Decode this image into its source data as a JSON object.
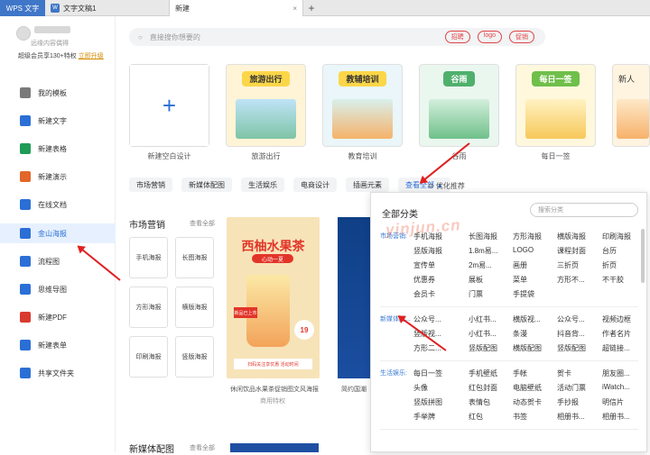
{
  "tabs": {
    "wps_label": "WPS 文字",
    "doc_label": "文字文稿1",
    "new_label": "新建",
    "close": "×",
    "add": "+"
  },
  "user": {
    "subtitle": "远缘内容偶得",
    "vip_text": "超级会员享130+特权",
    "vip_link": "立即升级"
  },
  "nav": [
    {
      "label": "我的模板",
      "icon": "template-icon",
      "color": "#7a7a7a"
    },
    {
      "label": "新建文字",
      "icon": "doc-icon",
      "color": "#2b6fd6"
    },
    {
      "label": "新建表格",
      "icon": "sheet-icon",
      "color": "#1e9b57"
    },
    {
      "label": "新建演示",
      "icon": "slides-icon",
      "color": "#e2662a"
    },
    {
      "label": "在线文档",
      "icon": "cloud-doc-icon",
      "color": "#2b6fd6"
    },
    {
      "label": "金山海报",
      "icon": "poster-icon",
      "color": "#2b6fd6"
    },
    {
      "label": "流程图",
      "icon": "flowchart-icon",
      "color": "#2b6fd6"
    },
    {
      "label": "思维导图",
      "icon": "mindmap-icon",
      "color": "#2b6fd6"
    },
    {
      "label": "新建PDF",
      "icon": "pdf-icon",
      "color": "#d93a30"
    },
    {
      "label": "新建表单",
      "icon": "form-icon",
      "color": "#2b6fd6"
    },
    {
      "label": "共享文件夹",
      "icon": "shared-folder-icon",
      "color": "#2b6fd6"
    }
  ],
  "search": {
    "placeholder": "直接搜你想要的",
    "chips": [
      "招聘",
      "logo",
      "促销"
    ]
  },
  "cards": [
    {
      "label": "新建空白设计",
      "head": ""
    },
    {
      "label": "旅游出行",
      "head": "旅游出行"
    },
    {
      "label": "教育培训",
      "head": "教辅培训"
    },
    {
      "label": "谷雨",
      "head": "谷雨"
    },
    {
      "label": "每日一签",
      "head": "每日一签"
    },
    {
      "label": "",
      "head": "新人"
    }
  ],
  "filters": [
    "市场营销",
    "新媒体配图",
    "生活娱乐",
    "电商设计",
    "插画元素",
    "查看全部 ▲"
  ],
  "filters_extra": "⊙ 优化推荐",
  "section": {
    "title": "市场营销",
    "more": "查看全部",
    "boxes": [
      "手机海报",
      "长图海报",
      "方形海报",
      "横版海报",
      "印刷海报",
      "竖版海报"
    ]
  },
  "section2": {
    "title": "新媒体配图",
    "more": "查看全部"
  },
  "poster1": {
    "title": "西柚水果茶",
    "badge": "心动一夏",
    "tag": "新品已上市",
    "price": "19",
    "foot": "扫码关注享优惠 活动时间",
    "caption": "休闲饮品水果茶促销图文风海报",
    "sub": "商用特权"
  },
  "poster2": {
    "caption": "简约国潮"
  },
  "dropdown": {
    "title": "全部分类",
    "search_placeholder": "搜索分类",
    "categories": [
      {
        "name": "市场营销:",
        "rows": [
          [
            "手机海报",
            "长图海报",
            "方形海报",
            "横版海报",
            "印刷海报"
          ],
          [
            "竖版海报",
            "1.8m易...",
            "LOGO",
            "课程封面",
            "台历"
          ],
          [
            "宣传单",
            "2m易...",
            "画册",
            "三折页",
            "折页"
          ],
          [
            "优惠券",
            "展板",
            "菜单",
            "方形不...",
            "不干胶"
          ],
          [
            "会员卡",
            "门票",
            "手提袋"
          ]
        ]
      },
      {
        "name": "新媒体配...",
        "rows": [
          [
            "公众号...",
            "小红书...",
            "横版视...",
            "公众号...",
            "视频边框"
          ],
          [
            "竖版视...",
            "小红书...",
            "条漫",
            "抖音背...",
            "作者名片"
          ],
          [
            "方形二...",
            "竖版配图",
            "横版配图",
            "竖版配图",
            "超链接..."
          ]
        ]
      },
      {
        "name": "生活娱乐:",
        "rows": [
          [
            "每日一签",
            "手机壁纸",
            "手帐",
            "贺卡",
            "朋友圈..."
          ],
          [
            "头像",
            "红包封面",
            "电脑壁纸",
            "活动门票",
            "iWatch..."
          ],
          [
            "竖版拼图",
            "表情包",
            "动态贺卡",
            "手抄报",
            "明信片"
          ],
          [
            "手举牌",
            "红包",
            "书签",
            "相册书...",
            "相册书..."
          ]
        ]
      }
    ]
  },
  "watermark": "yinjun.cn",
  "colors": {
    "accent": "#2b6fd6",
    "wps_blue": "#3f76c7",
    "arrow_red": "#e02020",
    "chip_red": "#e24444"
  }
}
